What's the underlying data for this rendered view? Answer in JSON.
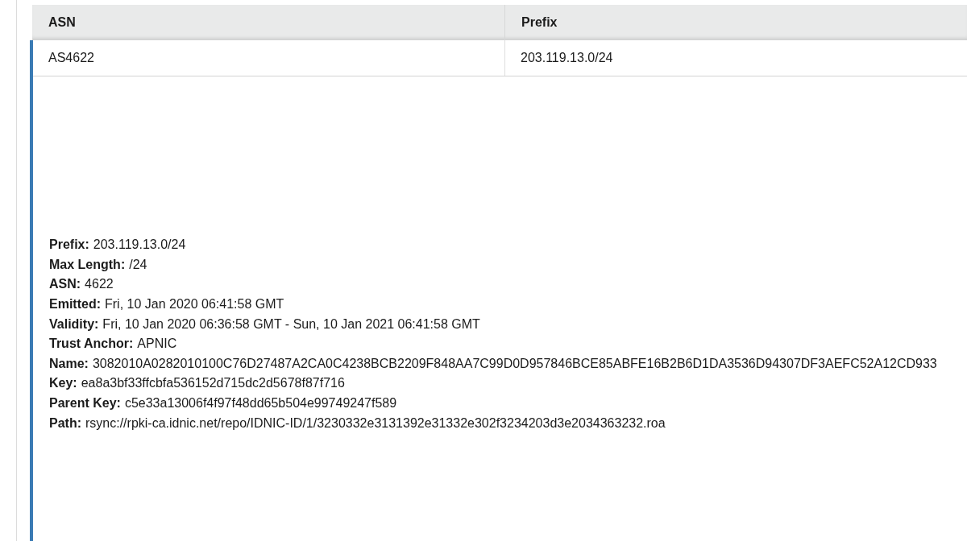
{
  "table": {
    "columns": [
      "ASN",
      "Prefix"
    ],
    "rows": [
      {
        "cells": [
          "AS4622",
          "203.119.13.0/24"
        ],
        "expanded": true,
        "details": [
          {
            "label": "Prefix:",
            "value": "203.119.13.0/24"
          },
          {
            "label": "Max Length:",
            "value": "/24"
          },
          {
            "label": "ASN:",
            "value": "4622"
          },
          {
            "label": "Emitted:",
            "value": "Fri, 10 Jan 2020 06:41:58 GMT"
          },
          {
            "label": "Validity:",
            "value": "Fri, 10 Jan 2020 06:36:58 GMT - Sun, 10 Jan 2021 06:41:58 GMT"
          },
          {
            "label": "Trust Anchor:",
            "value": "APNIC"
          },
          {
            "label": "Name:",
            "value": "3082010A0282010100C76D27487A2CA0C4238BCB2209F848AA7C99D0D957846BCE85ABFE16B2B6D1DA3536D94307DF3AEFC52A12CD933"
          },
          {
            "label": "Key:",
            "value": "ea8a3bf33ffcbfa536152d715dc2d5678f87f716"
          },
          {
            "label": "Parent Key:",
            "value": "c5e33a13006f4f97f48dd65b504e99749247f589"
          },
          {
            "label": "Path:",
            "value": "rsync://rpki-ca.idnic.net/repo/IDNIC-ID/1/3230332e3131392e31332e302f3234203d3e2034363232.roa"
          }
        ]
      }
    ]
  }
}
